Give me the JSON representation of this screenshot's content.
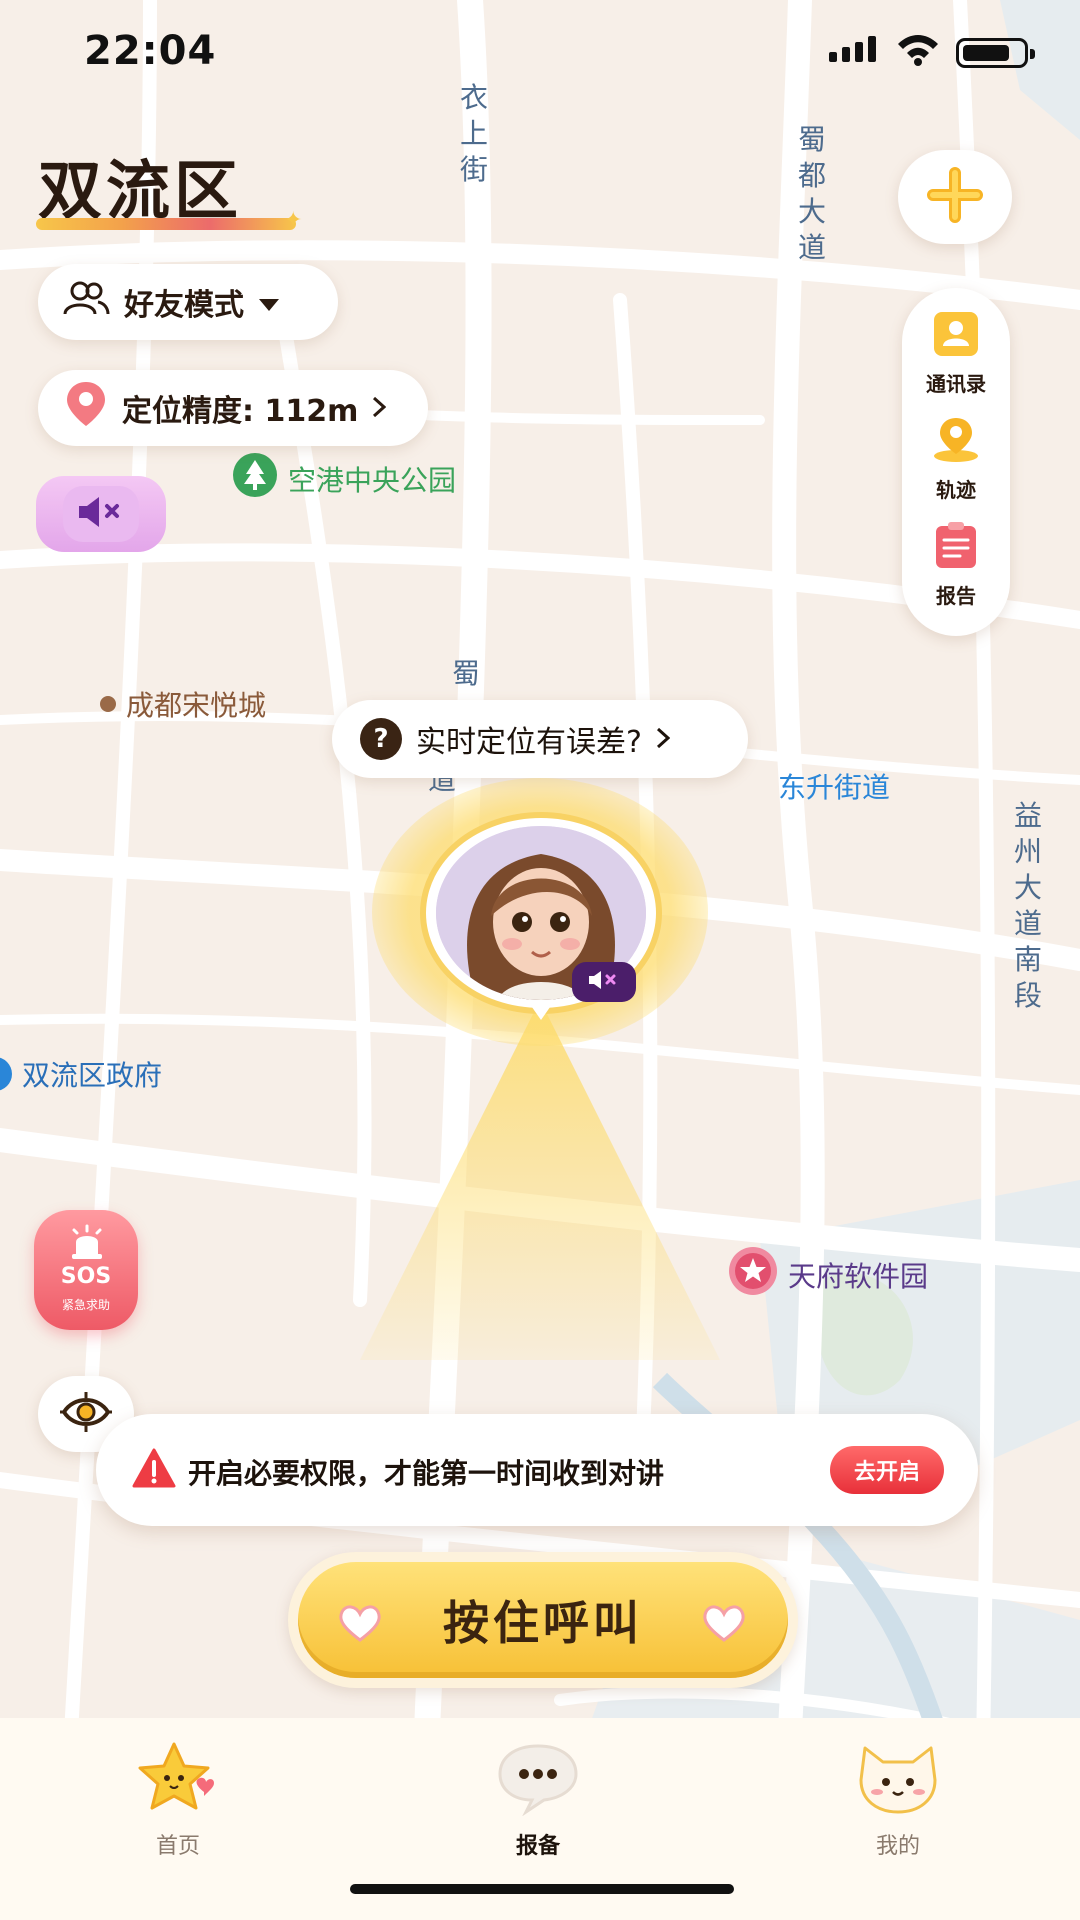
{
  "status_bar": {
    "time": "22:04"
  },
  "header": {
    "district": "双流区",
    "mode_label": "好友模式",
    "accuracy_label": "定位精度: 112m"
  },
  "map": {
    "pois": {
      "park": "空港中央公园",
      "mall": "成都宋悦城",
      "subdistrict": "东升街道",
      "government": "双流区政府",
      "software_park": "天府软件园"
    },
    "roads": {
      "yishang": "衣上街",
      "shudu": "蜀都大道",
      "yizhou": "益州大道南段",
      "middle": "蜀",
      "middle_tail": "道"
    }
  },
  "tools": {
    "contacts": "通讯录",
    "track": "轨迹",
    "report": "报告"
  },
  "location_hint": "实时定位有误差?",
  "sos": {
    "title": "SOS",
    "subtitle": "紧急求助"
  },
  "permission_banner": {
    "message": "开启必要权限，才能第一时间收到对讲",
    "action": "去开启"
  },
  "call_button": "按住呼叫",
  "nav": {
    "items": [
      {
        "label": "首页",
        "icon": "star-face-icon"
      },
      {
        "label": "报备",
        "icon": "chat-bubble-icon"
      },
      {
        "label": "我的",
        "icon": "cat-face-icon"
      }
    ],
    "active_index": 1
  },
  "colors": {
    "accent_yellow": "#f7c035",
    "danger_red": "#e8303a",
    "sos_pink": "#ee5a66",
    "text_dark": "#2a1a10",
    "park_green": "#3aa35a",
    "poi_blue": "#2a86d8"
  }
}
